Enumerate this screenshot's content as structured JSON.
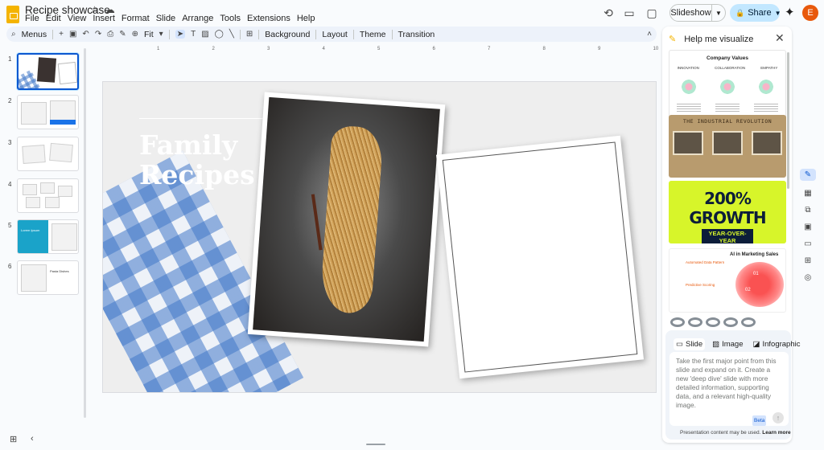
{
  "app": {
    "title": "Recipe showcase"
  },
  "menu": [
    "File",
    "Edit",
    "View",
    "Insert",
    "Format",
    "Slide",
    "Arrange",
    "Tools",
    "Extensions",
    "Help"
  ],
  "topbar": {
    "slideshow": "Slideshow",
    "share": "Share",
    "avatar_initial": "E",
    "icons": [
      "history-icon",
      "comment-icon",
      "video-call-icon",
      "gemini-sparkle-icon"
    ]
  },
  "toolbar": {
    "menus": "Menus",
    "zoom": "Fit",
    "background": "Background",
    "layout": "Layout",
    "theme": "Theme",
    "transition": "Transition"
  },
  "filmstrip": {
    "numbers": [
      "1",
      "2",
      "3",
      "4",
      "5",
      "6"
    ],
    "slide6_title": "Pasta Dishes",
    "slide5_title": "Lorem Ipsum"
  },
  "slide": {
    "title_line1": "Family",
    "title_line2": "Recipes"
  },
  "panel": {
    "title": "Help me visualize",
    "card1": {
      "title": "Company Values",
      "columns": [
        "INNOVATION",
        "COLLABORATION",
        "EMPATHY"
      ]
    },
    "card2": {
      "title": "THE INDUSTRIAL REVOLUTION"
    },
    "card3": {
      "title": "200% GROWTH",
      "subtitle": "YEAR-OVER-YEAR"
    },
    "card4": {
      "title": "AI in Marketing Sales",
      "bullets": [
        "Automated Data Pattern",
        "Predictive Scoring"
      ],
      "blob_labels": [
        "01",
        "02"
      ]
    },
    "tabs": [
      "Slide",
      "Image",
      "Infographic"
    ],
    "prompt_placeholder": "Take the first major point from this slide and expand on it. Create a new 'deep dive' slide with more detailed information, supporting data, and a relevant high-quality image.",
    "beta": "Beta",
    "disclaimer": "Presentation content may be used.",
    "learn_more": "Learn more"
  },
  "colors": {
    "accent": "#0b57d0",
    "share_bg": "#c2e7ff",
    "avatar": "#e8590c",
    "growth_bg": "#d7f52a",
    "growth_text": "#0c1d3a"
  }
}
